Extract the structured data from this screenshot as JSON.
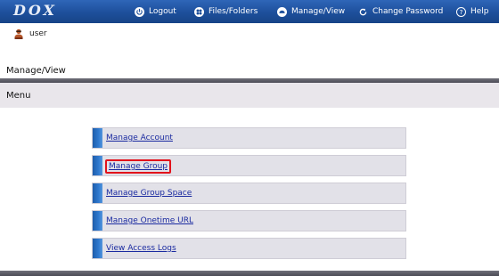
{
  "app": {
    "logo": "DOX"
  },
  "nav": [
    {
      "label": "Logout",
      "icon": "logout-icon"
    },
    {
      "label": "Files/Folders",
      "icon": "files-folders-icon"
    },
    {
      "label": "Manage/View",
      "icon": "manage-view-icon"
    },
    {
      "label": "Change Password",
      "icon": "change-password-icon"
    },
    {
      "label": "Help",
      "icon": "help-icon"
    }
  ],
  "user": {
    "name": "user",
    "icon": "user-avatar-icon"
  },
  "section": {
    "title": "Manage/View"
  },
  "menu": {
    "title": "Menu",
    "items": [
      {
        "label": "Manage Account"
      },
      {
        "label": "Manage Group",
        "highlighted": true
      },
      {
        "label": "Manage Group Space"
      },
      {
        "label": "Manage Onetime URL"
      },
      {
        "label": "View Access Logs"
      }
    ]
  },
  "colors": {
    "topbar": "#1d4f9b",
    "link": "#1a2aa0",
    "highlight": "#e2121b",
    "menu_header_bg": "#e9e6eb"
  }
}
